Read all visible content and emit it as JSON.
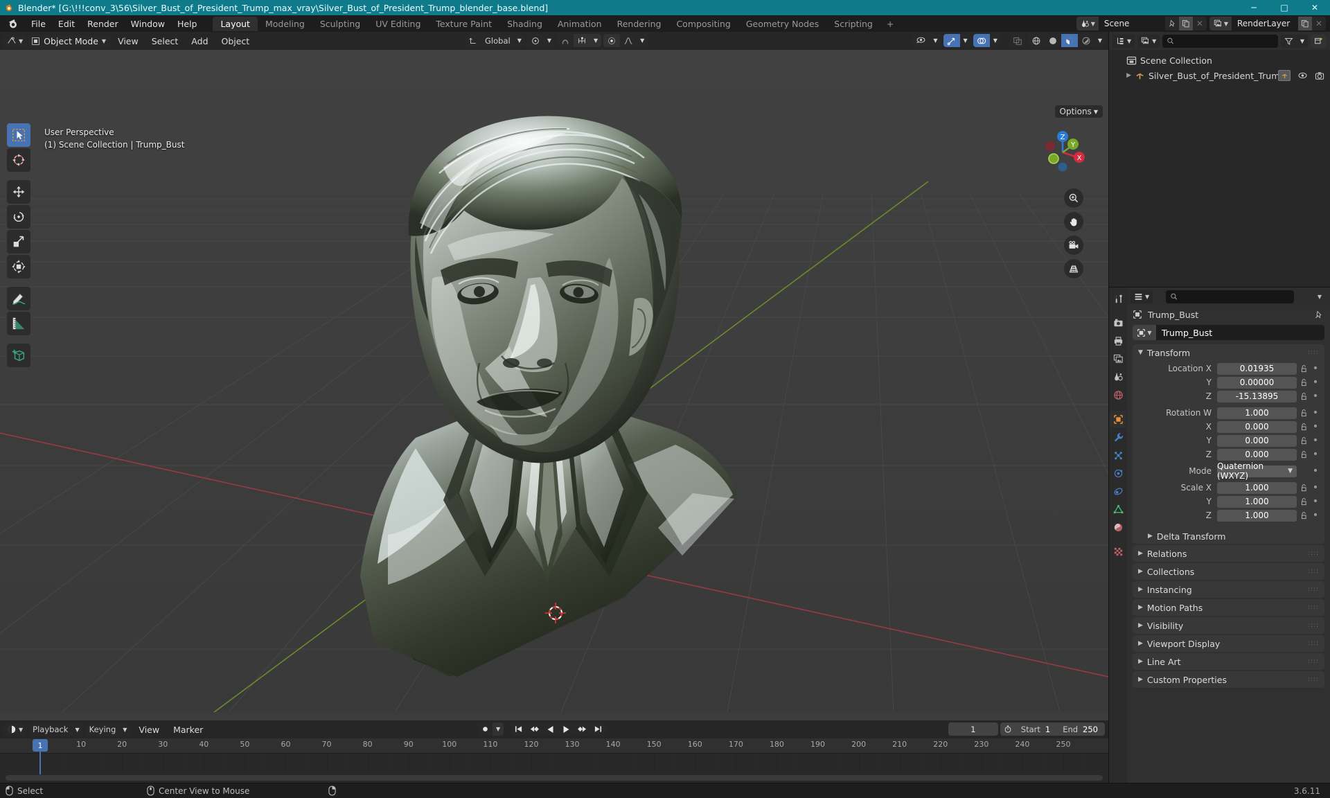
{
  "window": {
    "title": "Blender* [G:\\!!!conv_3\\56\\Silver_Bust_of_President_Trump_max_vray\\Silver_Bust_of_President_Trump_blender_base.blend]",
    "minimize": "─",
    "maximize": "□",
    "close": "✕"
  },
  "topbar": {
    "menus": [
      "File",
      "Edit",
      "Render",
      "Window",
      "Help"
    ],
    "workspaces": [
      {
        "label": "Layout",
        "active": true
      },
      {
        "label": "Modeling",
        "active": false
      },
      {
        "label": "Sculpting",
        "active": false
      },
      {
        "label": "UV Editing",
        "active": false
      },
      {
        "label": "Texture Paint",
        "active": false
      },
      {
        "label": "Shading",
        "active": false
      },
      {
        "label": "Animation",
        "active": false
      },
      {
        "label": "Rendering",
        "active": false
      },
      {
        "label": "Compositing",
        "active": false
      },
      {
        "label": "Geometry Nodes",
        "active": false
      },
      {
        "label": "Scripting",
        "active": false
      }
    ],
    "add_workspace": "+",
    "scene_name": "Scene",
    "viewlayer_name": "RenderLayer"
  },
  "viewport_header": {
    "mode": "Object Mode",
    "menus": [
      "View",
      "Select",
      "Add",
      "Object"
    ],
    "transform_orientation": "Global",
    "options_label": "Options"
  },
  "viewport": {
    "perspective_label": "User Perspective",
    "collection_label": "(1) Scene Collection | Trump_Bust",
    "gizmo_axes": [
      {
        "name": "Z",
        "color": "#2b7ad4"
      },
      {
        "name": "Y",
        "color": "#78a92a"
      },
      {
        "name": "X",
        "color": "#d62b3f"
      }
    ],
    "nav_icons": [
      "zoom-icon",
      "hand-icon",
      "camera-icon",
      "grid-icon"
    ],
    "tools": [
      {
        "name": "tweak-tool",
        "active": true
      },
      {
        "name": "cursor-tool",
        "active": false
      },
      {
        "name": "move-tool",
        "active": false
      },
      {
        "name": "rotate-tool",
        "active": false
      },
      {
        "name": "scale-tool",
        "active": false
      },
      {
        "name": "transform-tool",
        "active": false
      },
      {
        "name": "annotate-tool",
        "active": false
      },
      {
        "name": "measure-tool",
        "active": false
      },
      {
        "name": "add-cube-tool",
        "active": false
      }
    ]
  },
  "outliner": {
    "search_placeholder": "",
    "rows": [
      {
        "label": "Scene Collection",
        "indent": 0,
        "icon": "collection-icon"
      },
      {
        "label": "Silver_Bust_of_President_Trump",
        "indent": 1,
        "icon": "empty-axes-icon"
      }
    ]
  },
  "properties": {
    "breadcrumb": "Trump_Bust",
    "object_name": "Trump_Bust",
    "search_placeholder": "",
    "transform": {
      "title": "Transform",
      "rows": [
        {
          "label": "Location X",
          "value": "0.01935"
        },
        {
          "label": "Y",
          "value": "0.00000"
        },
        {
          "label": "Z",
          "value": "-15.13895"
        },
        {
          "label": "Rotation W",
          "value": "1.000",
          "gap": true
        },
        {
          "label": "X",
          "value": "0.000"
        },
        {
          "label": "Y",
          "value": "0.000"
        },
        {
          "label": "Z",
          "value": "0.000"
        },
        {
          "label": "Mode",
          "value": "Quaternion (WXYZ)",
          "dropdown": true,
          "gap": true
        },
        {
          "label": "Scale X",
          "value": "1.000",
          "gap": true
        },
        {
          "label": "Y",
          "value": "1.000"
        },
        {
          "label": "Z",
          "value": "1.000"
        }
      ],
      "delta_transform": "Delta Transform"
    },
    "panels": [
      "Relations",
      "Collections",
      "Instancing",
      "Motion Paths",
      "Visibility",
      "Viewport Display",
      "Line Art",
      "Custom Properties"
    ]
  },
  "timeline": {
    "editor_menu": "timeline-editor-icon",
    "menus": [
      "Playback",
      "Keying",
      "View",
      "Marker"
    ],
    "current_frame": "1",
    "start_label": "Start",
    "start_value": "1",
    "end_label": "End",
    "end_value": "250",
    "ticks": [
      "1",
      "10",
      "20",
      "30",
      "40",
      "50",
      "60",
      "70",
      "80",
      "90",
      "100",
      "110",
      "120",
      "130",
      "140",
      "150",
      "160",
      "170",
      "180",
      "190",
      "200",
      "210",
      "220",
      "230",
      "240",
      "250"
    ],
    "playhead_frame": "1"
  },
  "statusbar": {
    "items": [
      {
        "icon": "mouse-left-icon",
        "label": "Select"
      },
      {
        "icon": "mouse-middle-icon",
        "label": "Center View to Mouse"
      },
      {
        "icon": "mouse-right-icon",
        "label": ""
      }
    ],
    "version": "3.6.11"
  },
  "colors": {
    "accent": "#4772b3",
    "title_bar": "#0f7b8a",
    "axis_x": "#d62b3f",
    "axis_y": "#78a92a",
    "axis_z": "#2b7ad4",
    "orange": "#e8913a"
  }
}
